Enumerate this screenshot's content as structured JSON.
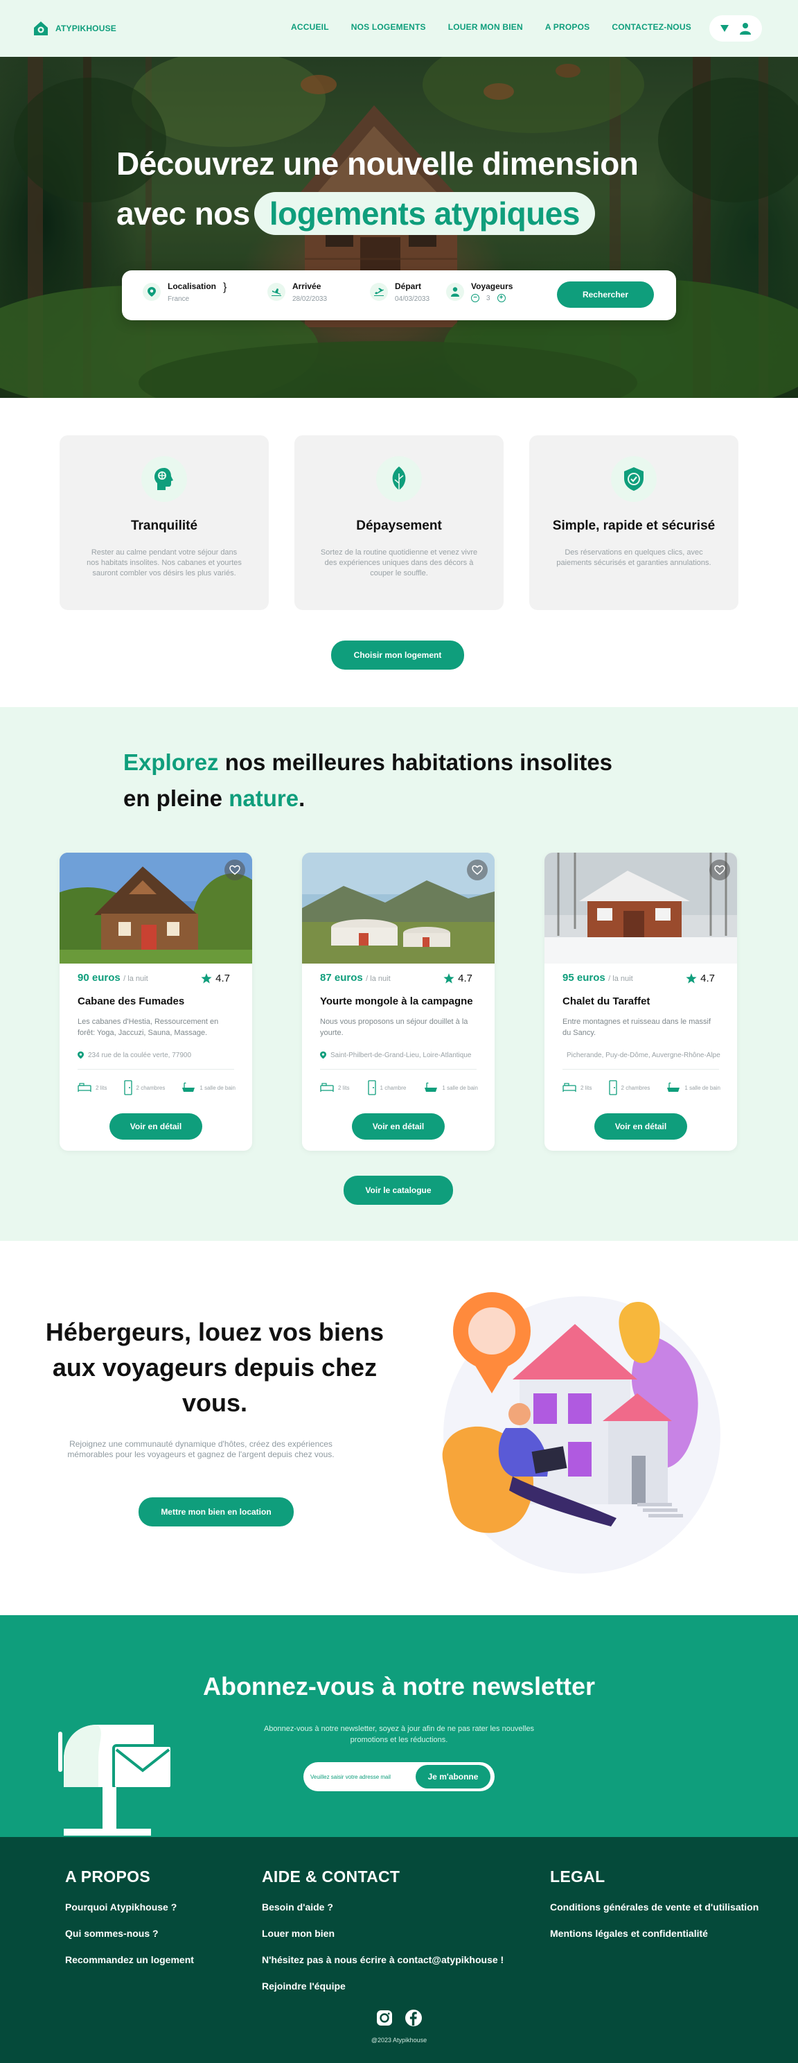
{
  "brand": {
    "name": "ATYPIKHOUSE",
    "accent": "#0f9e7c",
    "light": "#e9f8ef",
    "dark": "#054a3a"
  },
  "nav": {
    "links": [
      "ACCUEIL",
      "NOS LOGEMENTS",
      "LOUER MON BIEN",
      "A PROPOS",
      "CONTACTEZ-NOUS"
    ],
    "icons": [
      "chevron-down-icon",
      "user-icon"
    ]
  },
  "hero": {
    "title_part1": "Découvrez une nouvelle  dimension",
    "title_part2": "avec nos",
    "title_highlight": "logements  atypiques"
  },
  "search": {
    "location": {
      "label": "Localisation",
      "value": "France"
    },
    "arrival": {
      "label": "Arrivée",
      "value": "28/02/2033"
    },
    "departure": {
      "label": "Départ",
      "value": "04/03/2033"
    },
    "travelers": {
      "label": "Voyageurs",
      "value": "3",
      "minus": "−",
      "plus": "+"
    },
    "button": "Rechercher"
  },
  "features": [
    {
      "icon": "brain-icon",
      "title": "Tranquilité",
      "desc": "Rester au calme pendant votre séjour dans nos habitats insolites. Nos cabanes et yourtes sauront combler vos désirs les plus variés."
    },
    {
      "icon": "leaf-icon",
      "title": "Dépaysement",
      "desc": "Sortez de la routine quotidienne et venez vivre des expériences uniques dans des décors à couper le souffle."
    },
    {
      "icon": "shield-check-icon",
      "title": "Simple, rapide et sécurisé",
      "desc": "Des réservations en quelques clics, avec paiements sécurisés et garanties annulations."
    }
  ],
  "features_button": "Choisir mon logement",
  "listings": {
    "title_green1": "Explorez",
    "title_rest1": " nos meilleures habitations insolites",
    "title_rest2": "en pleine ",
    "title_green2": "nature",
    "title_dot": ".",
    "per_night": "/ la nuit",
    "detail_button": "Voir en détail",
    "catalog_button": "Voir le catalogue",
    "items": [
      {
        "price": "90 euros",
        "rating": "4.7",
        "name": "Cabane des Fumades",
        "desc": "Les cabanes d'Hestia, Ressourcement en forêt: Yoga, Jaccuzi, Sauna, Massage.",
        "address": "234 rue de la coulée verte, 77900",
        "beds": "2 lits",
        "rooms": "2 chambres",
        "baths": "1 salle de bain"
      },
      {
        "price": "87 euros",
        "rating": "4.7",
        "name": "Yourte mongole à la campagne",
        "desc": "Nous vous proposons un séjour douillet à la yourte.",
        "address": "Saint-Philbert-de-Grand-Lieu, Loire-Atlantique",
        "beds": "2 lits",
        "rooms": "1 chambre",
        "baths": "1 salle de bain"
      },
      {
        "price": "95 euros",
        "rating": "4.7",
        "name": "Chalet du Taraffet",
        "desc": "Entre montagnes et ruisseau dans le massif du Sancy.",
        "address": "Picherande, Puy-de-Dôme, Auvergne-Rhône-Alpes",
        "beds": "2 lits",
        "rooms": "2 chambres",
        "baths": "1 salle de bain"
      }
    ]
  },
  "hosts": {
    "title": "Hébergeurs, louez vos biens aux voyageurs depuis chez vous.",
    "desc": "Rejoignez une communauté dynamique d'hôtes, créez des expériences mémorables pour les voyageurs et gagnez de l'argent depuis chez vous.",
    "button": "Mettre mon bien en location"
  },
  "newsletter": {
    "title": "Abonnez-vous à notre newsletter",
    "desc": "Abonnez-vous à notre newsletter, soyez à jour afin de ne pas rater les nouvelles promotions et les réductions.",
    "placeholder": "Veuillez saisir votre adresse mail",
    "button": "Je m'abonne"
  },
  "footer": {
    "about": {
      "title": "A PROPOS",
      "links": [
        "Pourquoi Atypikhouse ?",
        "Qui sommes-nous ?",
        "Recommandez un logement"
      ]
    },
    "help": {
      "title": "AIDE & CONTACT",
      "links": [
        "Besoin d'aide ?",
        "Louer mon bien",
        "N'hésitez pas à nous écrire à contact@atypikhouse !",
        "Rejoindre l'équipe"
      ]
    },
    "legal": {
      "title": "LEGAL",
      "links": [
        "Conditions générales de vente et d'utilisation",
        "Mentions légales et confidentialité"
      ]
    },
    "social": [
      "instagram-icon",
      "facebook-icon"
    ],
    "copyright": "@2023 Atypikhouse"
  }
}
